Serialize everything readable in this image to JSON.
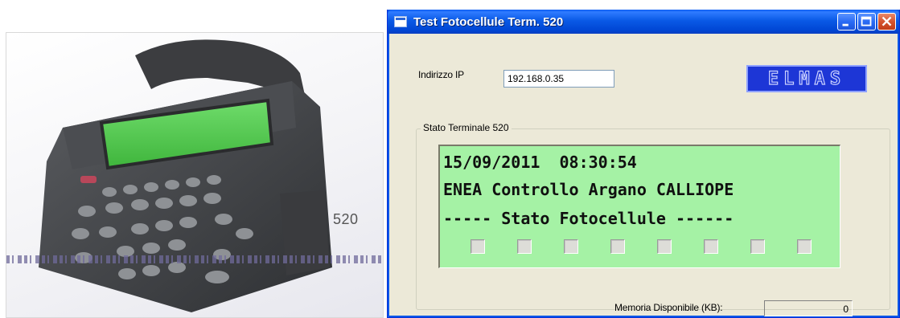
{
  "photo": {
    "model_label": "520"
  },
  "window": {
    "title": "Test Fotocellule Term. 520",
    "icon": "app-window-icon",
    "buttons": [
      "minimize-icon",
      "maximize-icon",
      "close-icon"
    ]
  },
  "ip": {
    "label": "Indirizzo IP",
    "value": "192.168.0.35"
  },
  "logo": {
    "text": "ELMAS"
  },
  "status_group": {
    "legend": "Stato Terminale 520",
    "lcd_lines": [
      "15/09/2011  08:30:54",
      "ENEA Controllo Argano CALLIOPE",
      "----- Stato Fotocellule ------"
    ],
    "photocells": [
      false,
      false,
      false,
      false,
      false,
      false,
      false,
      false
    ]
  },
  "memory": {
    "label": "Memoria Disponibile (KB):",
    "value": "0"
  },
  "colors": {
    "titlebar": "#0a5ae6",
    "lcd_background": "#a5f2a5",
    "logo_background": "#1d36d6",
    "dialog_background": "#ece9d8"
  }
}
